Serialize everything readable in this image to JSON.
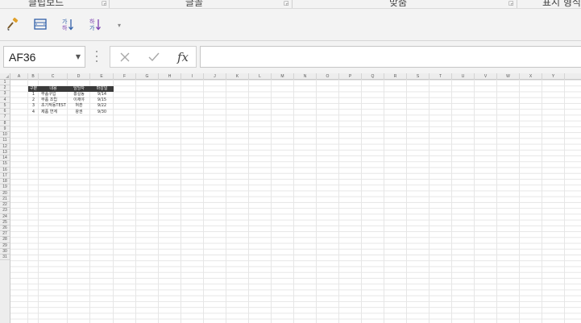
{
  "ribbon": {
    "groups": [
      {
        "label": "클립보드",
        "center": 60
      },
      {
        "label": "글꼴",
        "center": 242
      },
      {
        "label": "맞춤",
        "center": 495
      },
      {
        "label": "표시 형식",
        "center": 690
      }
    ]
  },
  "quick_toolbar": {
    "icons": [
      "format-painter-icon",
      "fit-column-icon",
      "sort-asc-icon",
      "sort-desc-icon"
    ]
  },
  "formula_bar": {
    "name_box": "AF36",
    "fx_label": "fx",
    "formula": ""
  },
  "sheet": {
    "columns": [
      "A",
      "B",
      "C",
      "D",
      "E",
      "F",
      "G",
      "H",
      "I",
      "J",
      "K",
      "L",
      "M",
      "N",
      "O",
      "P",
      "Q",
      "R",
      "S",
      "T",
      "U",
      "V",
      "W",
      "X",
      "Y"
    ],
    "row_count": 31,
    "table": {
      "headers": [
        "구분",
        "내용",
        "담당자",
        "마감일"
      ],
      "rows": [
        [
          "1",
          "부품구입",
          "홍길동",
          "9/14"
        ],
        [
          "2",
          "부품 조립",
          "이제야",
          "9/15"
        ],
        [
          "3",
          "초기작동TEST",
          "혀훈",
          "9/22"
        ],
        [
          "4",
          "제품 연계",
          "왕권",
          "9/30"
        ]
      ]
    }
  },
  "colors": {
    "header_fill": "#3a3a3a",
    "icon_blue": "#2f5fa8",
    "icon_purple": "#7a3fb0"
  }
}
